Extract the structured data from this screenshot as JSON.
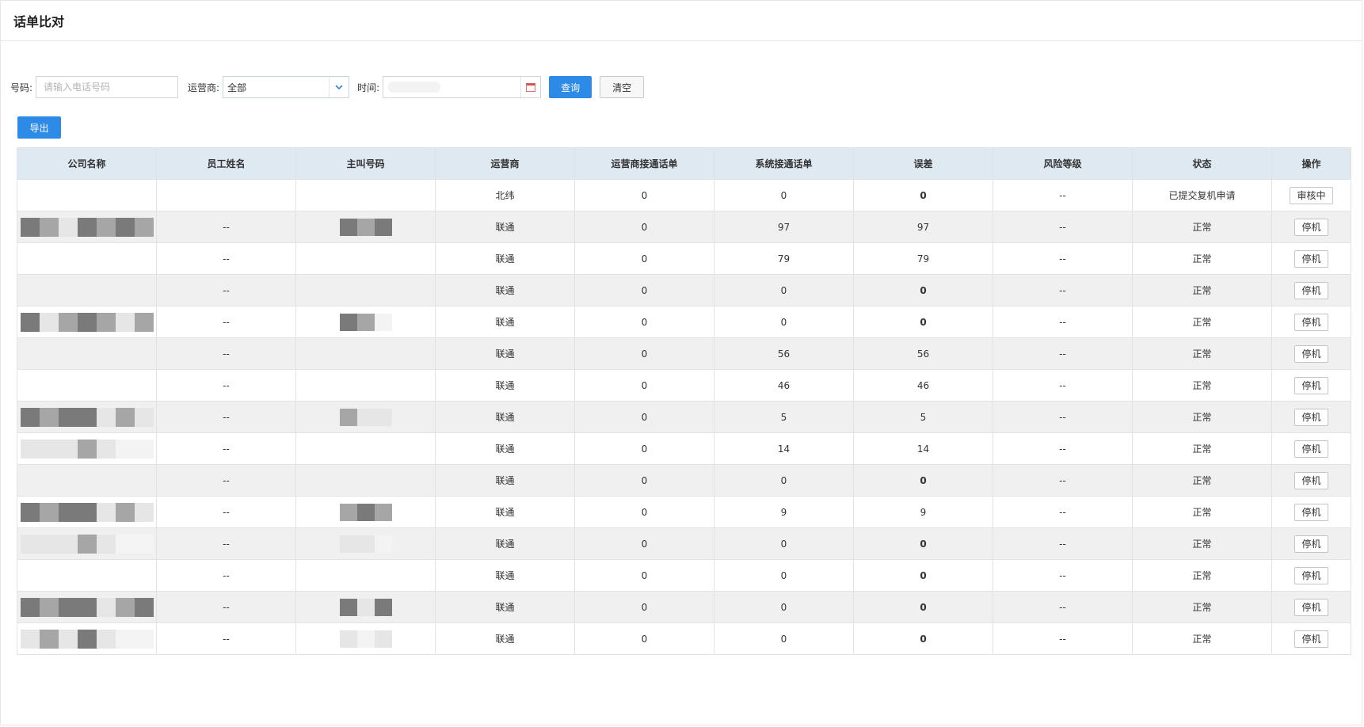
{
  "header": {
    "title": "话单比对"
  },
  "filters": {
    "phone_label": "号码:",
    "phone_placeholder": "请输入电话号码",
    "carrier_label": "运营商:",
    "carrier_value": "全部",
    "time_label": "时间:",
    "query_label": "查询",
    "clear_label": "清空"
  },
  "toolbar": {
    "export_label": "导出"
  },
  "table": {
    "columns": [
      "公司名称",
      "员工姓名",
      "主叫号码",
      "运营商",
      "运营商接通话单",
      "系统接通话单",
      "误差",
      "风险等级",
      "状态",
      "操作"
    ],
    "rows": [
      {
        "employee": "",
        "carrier": "北纬",
        "carrier_calls": "0",
        "system_calls": "0",
        "diff": "0",
        "risk": "--",
        "status": "已提交复机申请",
        "action": "审核中"
      },
      {
        "employee": "--",
        "carrier": "联通",
        "carrier_calls": "0",
        "system_calls": "97",
        "diff": "97",
        "risk": "--",
        "status": "正常",
        "action": "停机"
      },
      {
        "employee": "--",
        "carrier": "联通",
        "carrier_calls": "0",
        "system_calls": "79",
        "diff": "79",
        "risk": "--",
        "status": "正常",
        "action": "停机"
      },
      {
        "employee": "--",
        "carrier": "联通",
        "carrier_calls": "0",
        "system_calls": "0",
        "diff": "0",
        "risk": "--",
        "status": "正常",
        "action": "停机"
      },
      {
        "employee": "--",
        "carrier": "联通",
        "carrier_calls": "0",
        "system_calls": "0",
        "diff": "0",
        "risk": "--",
        "status": "正常",
        "action": "停机"
      },
      {
        "employee": "--",
        "carrier": "联通",
        "carrier_calls": "0",
        "system_calls": "56",
        "diff": "56",
        "risk": "--",
        "status": "正常",
        "action": "停机"
      },
      {
        "employee": "--",
        "carrier": "联通",
        "carrier_calls": "0",
        "system_calls": "46",
        "diff": "46",
        "risk": "--",
        "status": "正常",
        "action": "停机"
      },
      {
        "employee": "--",
        "carrier": "联通",
        "carrier_calls": "0",
        "system_calls": "5",
        "diff": "5",
        "risk": "--",
        "status": "正常",
        "action": "停机"
      },
      {
        "employee": "--",
        "carrier": "联通",
        "carrier_calls": "0",
        "system_calls": "14",
        "diff": "14",
        "risk": "--",
        "status": "正常",
        "action": "停机"
      },
      {
        "employee": "--",
        "carrier": "联通",
        "carrier_calls": "0",
        "system_calls": "0",
        "diff": "0",
        "risk": "--",
        "status": "正常",
        "action": "停机"
      },
      {
        "employee": "--",
        "carrier": "联通",
        "carrier_calls": "0",
        "system_calls": "9",
        "diff": "9",
        "risk": "--",
        "status": "正常",
        "action": "停机"
      },
      {
        "employee": "--",
        "carrier": "联通",
        "carrier_calls": "0",
        "system_calls": "0",
        "diff": "0",
        "risk": "--",
        "status": "正常",
        "action": "停机"
      },
      {
        "employee": "--",
        "carrier": "联通",
        "carrier_calls": "0",
        "system_calls": "0",
        "diff": "0",
        "risk": "--",
        "status": "正常",
        "action": "停机"
      },
      {
        "employee": "--",
        "carrier": "联通",
        "carrier_calls": "0",
        "system_calls": "0",
        "diff": "0",
        "risk": "--",
        "status": "正常",
        "action": "停机"
      },
      {
        "employee": "--",
        "carrier": "联通",
        "carrier_calls": "0",
        "system_calls": "0",
        "diff": "0",
        "risk": "--",
        "status": "正常",
        "action": "停机"
      }
    ]
  },
  "colors": {
    "primary": "#2d8ae6",
    "header_bg": "#dfe9f2",
    "stripe_bg": "#f0f0f0",
    "error_zero": "#e0463c",
    "mosaic_dark": "#7a7a7a",
    "mosaic_mid": "#a6a6a6",
    "mosaic_light": "#e6e6e6"
  },
  "icons": {
    "select_arrow": "chevron-down-icon",
    "date_picker": "calendar-icon"
  }
}
